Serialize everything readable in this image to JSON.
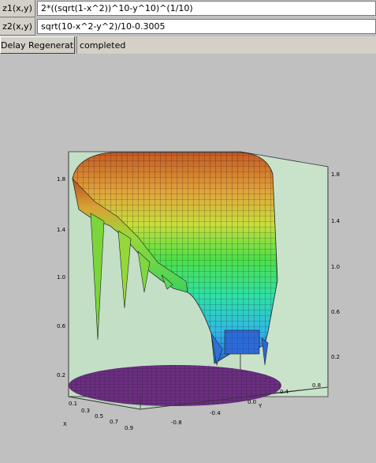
{
  "fields": {
    "z1_label": "z1(x,y)",
    "z1_value": "2*((sqrt(1-x^2))^10-y^10)^(1/10)",
    "z2_label": "z2(x,y)",
    "z2_value": "sqrt(10-x^2-y^2)/10-0.3005"
  },
  "status": {
    "button_label": "Delay Regeneration",
    "text": "completed"
  },
  "plot": {
    "left_axis_ticks": [
      "1.8",
      "1.4",
      "1.0",
      "0.6",
      "0.2"
    ],
    "right_axis_ticks": [
      "1.8",
      "1.4",
      "1.0",
      "0.6",
      "0.2"
    ],
    "x_axis_label": "X",
    "x_ticks": [
      "0.1",
      "0.3",
      "0.5",
      "0.7",
      "0.9"
    ],
    "y_axis_label": "Y",
    "y_ticks": [
      "-0.8",
      "-0.4",
      "0.0",
      "0.4",
      "0.8"
    ],
    "colors": {
      "box_face": "#c3dfc6",
      "top_surface": "#d87a2a",
      "base_disc": "#6b2f80"
    }
  }
}
